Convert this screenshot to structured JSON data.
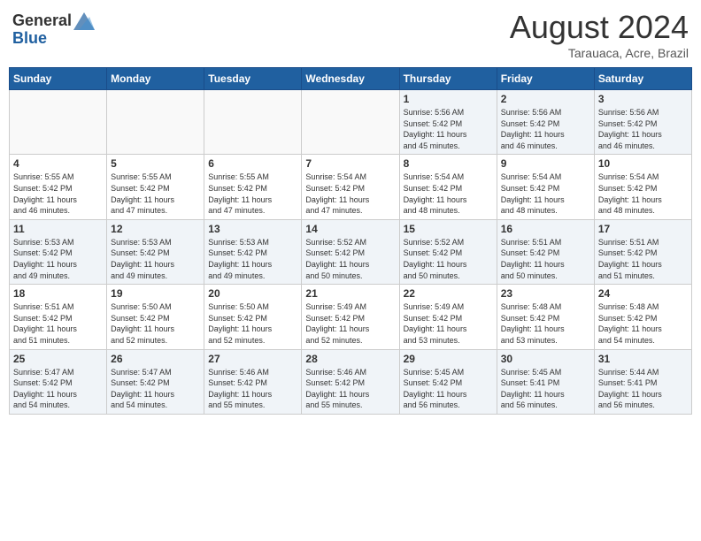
{
  "header": {
    "logo_general": "General",
    "logo_blue": "Blue",
    "month_year": "August 2024",
    "location": "Tarauaca, Acre, Brazil"
  },
  "days_of_week": [
    "Sunday",
    "Monday",
    "Tuesday",
    "Wednesday",
    "Thursday",
    "Friday",
    "Saturday"
  ],
  "weeks": [
    [
      {
        "day": "",
        "info": ""
      },
      {
        "day": "",
        "info": ""
      },
      {
        "day": "",
        "info": ""
      },
      {
        "day": "",
        "info": ""
      },
      {
        "day": "1",
        "info": "Sunrise: 5:56 AM\nSunset: 5:42 PM\nDaylight: 11 hours\nand 45 minutes."
      },
      {
        "day": "2",
        "info": "Sunrise: 5:56 AM\nSunset: 5:42 PM\nDaylight: 11 hours\nand 46 minutes."
      },
      {
        "day": "3",
        "info": "Sunrise: 5:56 AM\nSunset: 5:42 PM\nDaylight: 11 hours\nand 46 minutes."
      }
    ],
    [
      {
        "day": "4",
        "info": "Sunrise: 5:55 AM\nSunset: 5:42 PM\nDaylight: 11 hours\nand 46 minutes."
      },
      {
        "day": "5",
        "info": "Sunrise: 5:55 AM\nSunset: 5:42 PM\nDaylight: 11 hours\nand 47 minutes."
      },
      {
        "day": "6",
        "info": "Sunrise: 5:55 AM\nSunset: 5:42 PM\nDaylight: 11 hours\nand 47 minutes."
      },
      {
        "day": "7",
        "info": "Sunrise: 5:54 AM\nSunset: 5:42 PM\nDaylight: 11 hours\nand 47 minutes."
      },
      {
        "day": "8",
        "info": "Sunrise: 5:54 AM\nSunset: 5:42 PM\nDaylight: 11 hours\nand 48 minutes."
      },
      {
        "day": "9",
        "info": "Sunrise: 5:54 AM\nSunset: 5:42 PM\nDaylight: 11 hours\nand 48 minutes."
      },
      {
        "day": "10",
        "info": "Sunrise: 5:54 AM\nSunset: 5:42 PM\nDaylight: 11 hours\nand 48 minutes."
      }
    ],
    [
      {
        "day": "11",
        "info": "Sunrise: 5:53 AM\nSunset: 5:42 PM\nDaylight: 11 hours\nand 49 minutes."
      },
      {
        "day": "12",
        "info": "Sunrise: 5:53 AM\nSunset: 5:42 PM\nDaylight: 11 hours\nand 49 minutes."
      },
      {
        "day": "13",
        "info": "Sunrise: 5:53 AM\nSunset: 5:42 PM\nDaylight: 11 hours\nand 49 minutes."
      },
      {
        "day": "14",
        "info": "Sunrise: 5:52 AM\nSunset: 5:42 PM\nDaylight: 11 hours\nand 50 minutes."
      },
      {
        "day": "15",
        "info": "Sunrise: 5:52 AM\nSunset: 5:42 PM\nDaylight: 11 hours\nand 50 minutes."
      },
      {
        "day": "16",
        "info": "Sunrise: 5:51 AM\nSunset: 5:42 PM\nDaylight: 11 hours\nand 50 minutes."
      },
      {
        "day": "17",
        "info": "Sunrise: 5:51 AM\nSunset: 5:42 PM\nDaylight: 11 hours\nand 51 minutes."
      }
    ],
    [
      {
        "day": "18",
        "info": "Sunrise: 5:51 AM\nSunset: 5:42 PM\nDaylight: 11 hours\nand 51 minutes."
      },
      {
        "day": "19",
        "info": "Sunrise: 5:50 AM\nSunset: 5:42 PM\nDaylight: 11 hours\nand 52 minutes."
      },
      {
        "day": "20",
        "info": "Sunrise: 5:50 AM\nSunset: 5:42 PM\nDaylight: 11 hours\nand 52 minutes."
      },
      {
        "day": "21",
        "info": "Sunrise: 5:49 AM\nSunset: 5:42 PM\nDaylight: 11 hours\nand 52 minutes."
      },
      {
        "day": "22",
        "info": "Sunrise: 5:49 AM\nSunset: 5:42 PM\nDaylight: 11 hours\nand 53 minutes."
      },
      {
        "day": "23",
        "info": "Sunrise: 5:48 AM\nSunset: 5:42 PM\nDaylight: 11 hours\nand 53 minutes."
      },
      {
        "day": "24",
        "info": "Sunrise: 5:48 AM\nSunset: 5:42 PM\nDaylight: 11 hours\nand 54 minutes."
      }
    ],
    [
      {
        "day": "25",
        "info": "Sunrise: 5:47 AM\nSunset: 5:42 PM\nDaylight: 11 hours\nand 54 minutes."
      },
      {
        "day": "26",
        "info": "Sunrise: 5:47 AM\nSunset: 5:42 PM\nDaylight: 11 hours\nand 54 minutes."
      },
      {
        "day": "27",
        "info": "Sunrise: 5:46 AM\nSunset: 5:42 PM\nDaylight: 11 hours\nand 55 minutes."
      },
      {
        "day": "28",
        "info": "Sunrise: 5:46 AM\nSunset: 5:42 PM\nDaylight: 11 hours\nand 55 minutes."
      },
      {
        "day": "29",
        "info": "Sunrise: 5:45 AM\nSunset: 5:42 PM\nDaylight: 11 hours\nand 56 minutes."
      },
      {
        "day": "30",
        "info": "Sunrise: 5:45 AM\nSunset: 5:41 PM\nDaylight: 11 hours\nand 56 minutes."
      },
      {
        "day": "31",
        "info": "Sunrise: 5:44 AM\nSunset: 5:41 PM\nDaylight: 11 hours\nand 56 minutes."
      }
    ]
  ]
}
